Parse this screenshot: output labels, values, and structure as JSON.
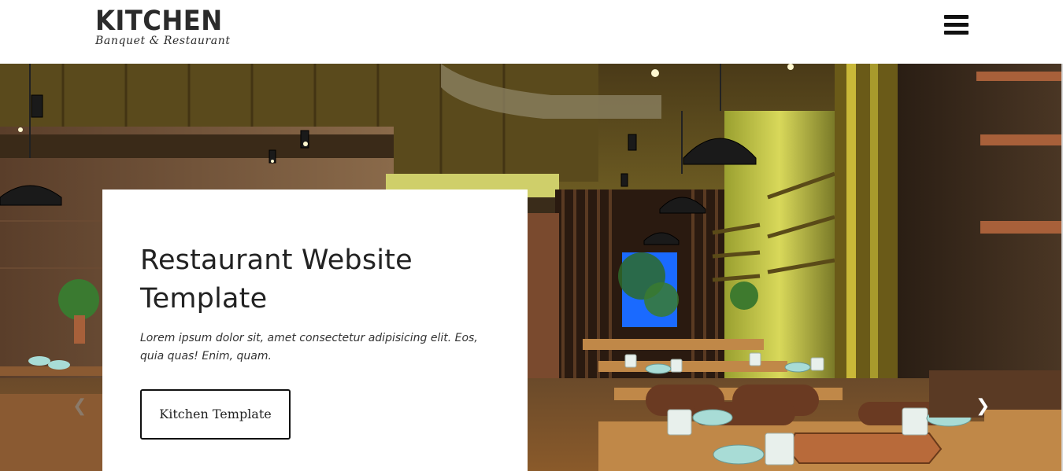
{
  "header": {
    "logo_title": "KITCHEN",
    "logo_subtitle": "Banquet & Restaurant",
    "menu_icon": "hamburger-menu-icon"
  },
  "hero": {
    "title": "Restaurant Website Template",
    "text": "Lorem ipsum dolor sit, amet consectetur adipisicing elit. Eos, quia quas! Enim, quam.",
    "button_label": "Kitchen Template",
    "prev_icon": "chevron-left-icon",
    "next_icon": "chevron-right-icon",
    "prev_glyph": "❮",
    "next_glyph": "❯"
  },
  "colors": {
    "text_dark": "#222222",
    "header_bg": "#ffffff",
    "accent_yellow": "#c9c23a"
  }
}
